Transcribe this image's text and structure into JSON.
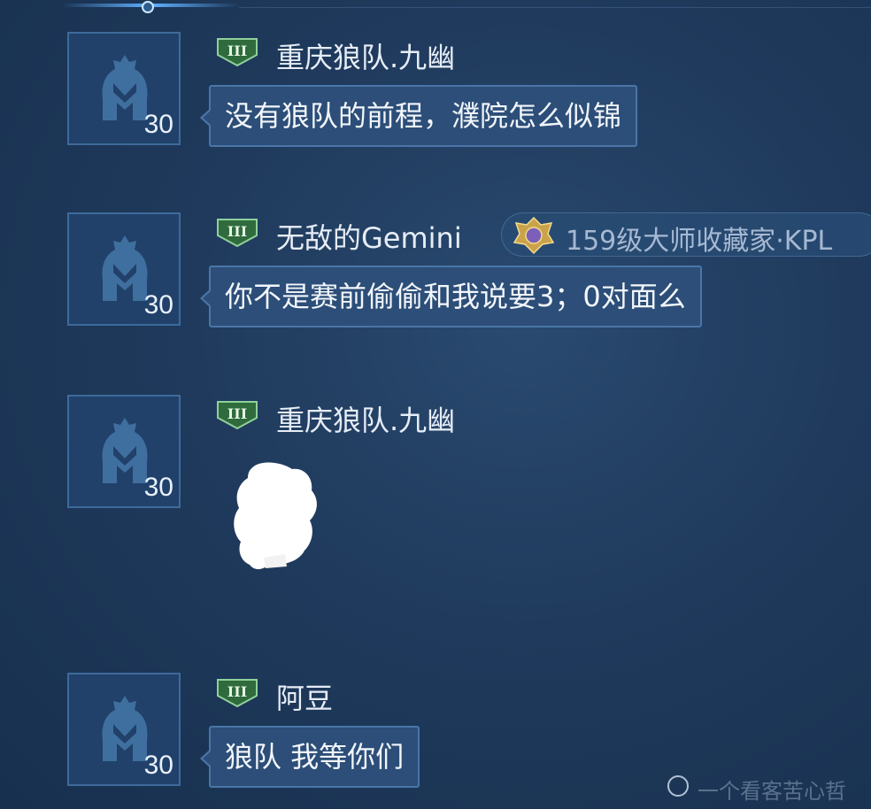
{
  "messages": [
    {
      "level": "30",
      "rank_badge": "III",
      "name": "重庆狼队.九幽",
      "text": "没有狼队的前程，濮院怎么似锦"
    },
    {
      "level": "30",
      "rank_badge": "III",
      "name": "无敌的Gemini",
      "title_badge": "159级大师收藏家·KPL",
      "text": "你不是赛前偷偷和我说要3；0对面么"
    },
    {
      "level": "30",
      "rank_badge": "III",
      "name": "重庆狼队.九幽",
      "sticker": "redacted-sticker"
    },
    {
      "level": "30",
      "rank_badge": "III",
      "name": "阿豆",
      "text": "狼队 我等你们"
    }
  ],
  "watermark": {
    "text": "一个看客苦心哲"
  },
  "colors": {
    "background": "#1f3a5c",
    "bubble": "#2c4e78",
    "bubble_border": "#4a76a8",
    "rank_badge": "#2f6b3c"
  }
}
